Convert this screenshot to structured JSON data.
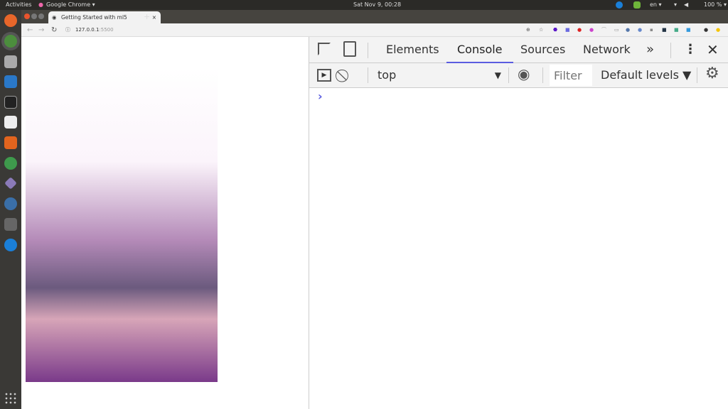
{
  "topbar": {
    "activities": "Activities",
    "app": "Google Chrome ▾",
    "clock": "Sat Nov  9, 00:28",
    "lang": "en ▾",
    "battery": "100 % ▾"
  },
  "browser": {
    "tab_title": "Getting Started with ml5",
    "new_tab": "+",
    "close_tab": "×",
    "url_host": "127.0.0.1",
    "url_port": ":5500"
  },
  "devtools": {
    "tabs": [
      "Elements",
      "Console",
      "Sources",
      "Network"
    ],
    "active_tab": "Console",
    "more": "»",
    "context": "top",
    "filter_placeholder": "Filter",
    "levels": "Default levels ▼",
    "prompt": "›",
    "accent": "#5a5ce0"
  }
}
